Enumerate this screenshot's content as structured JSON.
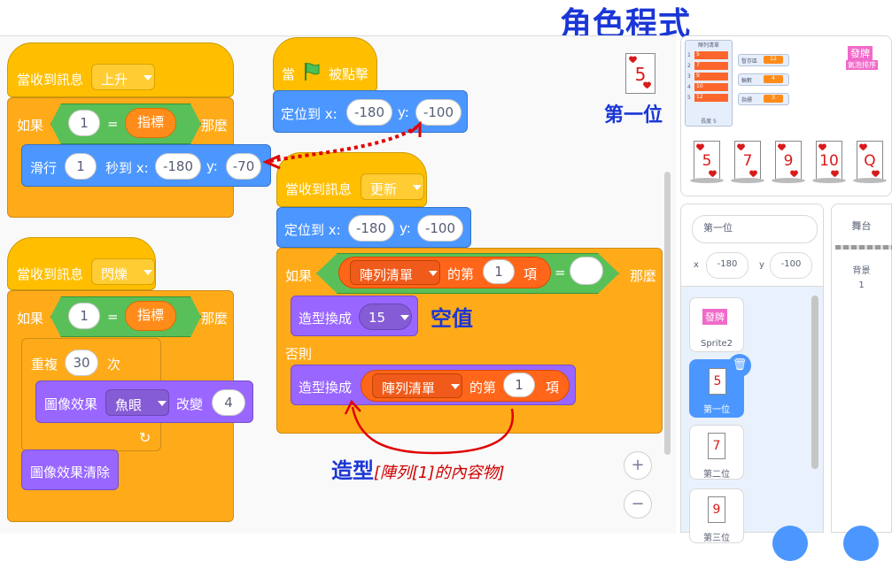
{
  "title": "角色程式",
  "annotations": {
    "empty_value": "空值",
    "costume_prefix": "造型",
    "costume_detail": "[陣列[1]的內容物]",
    "first_place": "第一位",
    "corner_card": "5"
  },
  "script1": {
    "hat_label": "當收到訊息",
    "hat_dropdown": "上升",
    "if_label": "如果",
    "left_value": "1",
    "eq": "=",
    "var_name": "指標",
    "then": "那麼",
    "glide_label": "滑行",
    "glide_secs": "1",
    "glide_mid": "秒到 x:",
    "x_val": "-180",
    "y_label": "y:",
    "y_val": "-70"
  },
  "script2": {
    "hat_label": "當收到訊息",
    "hat_dropdown": "閃爍",
    "if_label": "如果",
    "left_value": "1",
    "eq": "=",
    "var_name": "指標",
    "then": "那麼",
    "repeat_label": "重複",
    "repeat_count": "30",
    "repeat_unit": "次",
    "effect_label": "圖像效果",
    "effect_dd": "魚眼",
    "effect_change": "改變",
    "effect_amount": "4",
    "clear_label": "圖像效果清除"
  },
  "script3": {
    "when": "當",
    "clicked": "被點擊",
    "goto_label": "定位到 x:",
    "x_val": "-180",
    "y_label": "y:",
    "y_val": "-100"
  },
  "script4": {
    "hat_label": "當收到訊息",
    "hat_dropdown": "更新",
    "goto_label": "定位到 x:",
    "x_val": "-180",
    "y_label": "y:",
    "y_val": "-100",
    "if_label": "如果",
    "list_name": "陣列清單",
    "item_of": "的第",
    "index": "1",
    "item_unit": "項",
    "eq": "=",
    "then": "那麼",
    "switch_label": "造型換成",
    "costume_val": "15",
    "else_label": "否則",
    "switch_label2": "造型換成",
    "list_name2": "陣列清單",
    "item_of2": "的第",
    "index2": "1",
    "item_unit2": "項"
  },
  "stage": {
    "list_title": "陣列清單",
    "list_items": [
      {
        "idx": "1",
        "val": "5"
      },
      {
        "idx": "2",
        "val": "7"
      },
      {
        "idx": "3",
        "val": "9"
      },
      {
        "idx": "4",
        "val": "10"
      },
      {
        "idx": "5",
        "val": "12"
      }
    ],
    "list_footer": "長度 5",
    "monitors": [
      {
        "label": "暫存區",
        "value": "12"
      },
      {
        "label": "輪數",
        "value": "4"
      },
      {
        "label": "指標",
        "value": "3"
      }
    ],
    "deal_button": "發牌",
    "sort_button": "氣泡排序",
    "cards": [
      "5",
      "7",
      "9",
      "10",
      "Q"
    ]
  },
  "sprite_info": {
    "name": "第一位",
    "x_label": "x",
    "x_val": "-180",
    "y_label": "y",
    "y_val": "-100"
  },
  "stage_panel": {
    "title": "舞台",
    "backdrop_label": "背景",
    "backdrop_count": "1"
  },
  "sprites": [
    {
      "name": "Sprite2",
      "thumb": "發牌"
    },
    {
      "name": "第一位",
      "thumb": "5"
    },
    {
      "name": "第二位",
      "thumb": "7"
    },
    {
      "name": "第三位",
      "thumb": "9"
    }
  ],
  "zoom": {
    "in": "+",
    "out": "−"
  },
  "colors": {
    "event": "#ffbf00",
    "control": "#ffab19",
    "motion": "#4c97ff",
    "looks": "#9966ff",
    "operator": "#59c059",
    "variable": "#ff8c1a",
    "list": "#ff661a",
    "title": "#1a36d6",
    "annotation_red": "#e00000"
  }
}
